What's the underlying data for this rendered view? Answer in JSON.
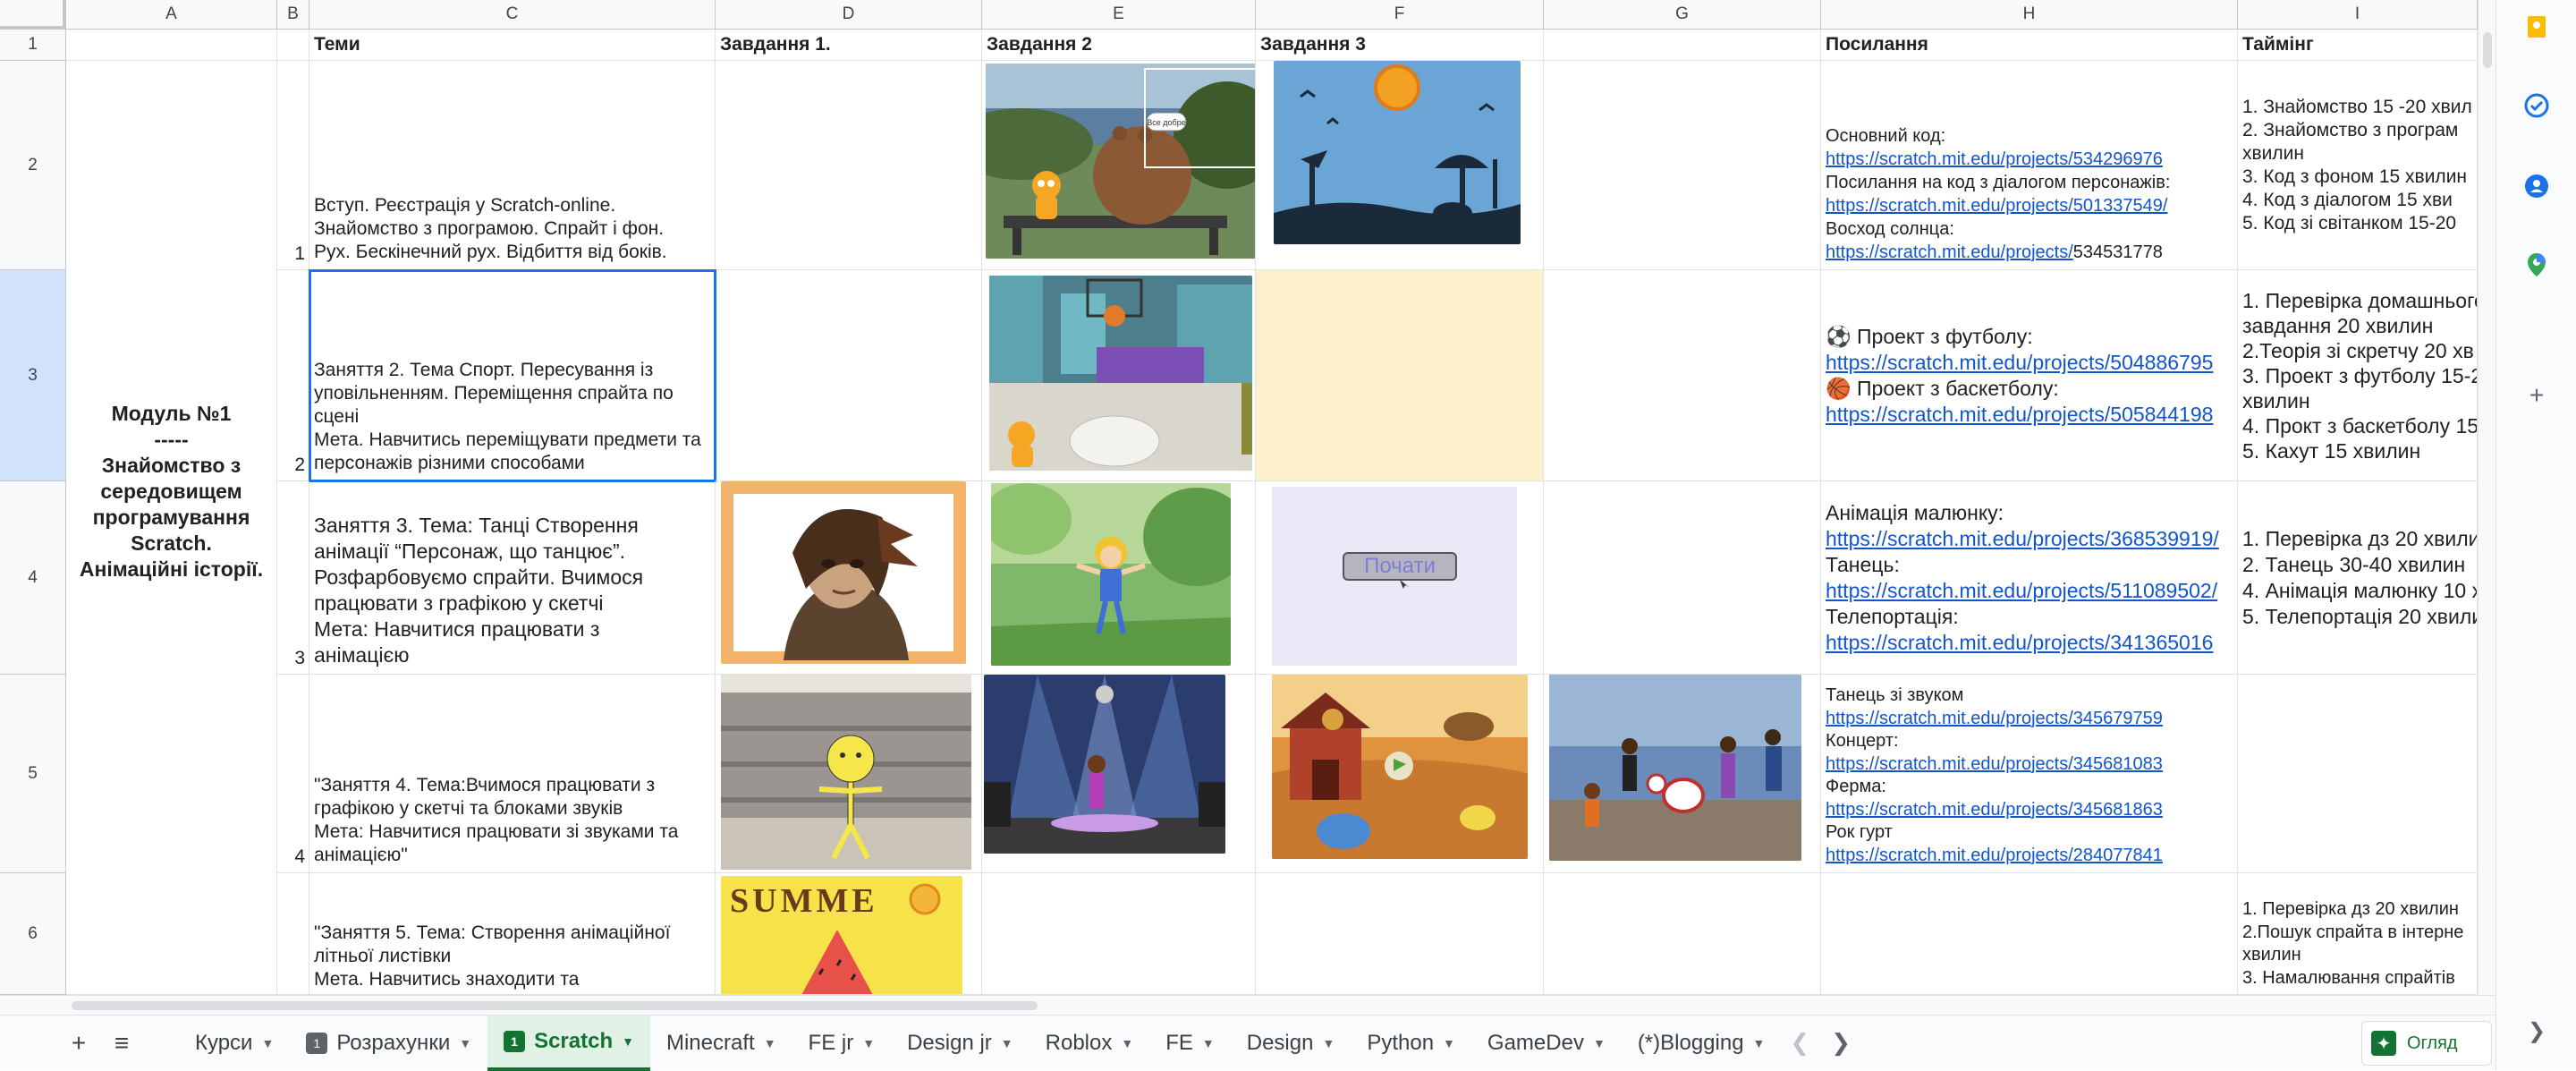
{
  "columns": [
    "A",
    "B",
    "C",
    "D",
    "E",
    "F",
    "G",
    "H",
    "I"
  ],
  "rows": [
    "1",
    "2",
    "3",
    "4",
    "5",
    "6"
  ],
  "headers": {
    "c": "Теми",
    "d": "Завдання 1.",
    "e": "Завдання 2",
    "f": "Завдання 3",
    "h": "Посилання",
    "i": "Таймінг"
  },
  "module": {
    "title": "Модуль №1",
    "dashes": "-----",
    "l1": "Знайомство з",
    "l2": "середовищем",
    "l3": "програмування",
    "l4": "Scratch.",
    "l5": "Анімаційні історії."
  },
  "lessons": [
    {
      "num": "1",
      "topic": [
        "Вступ. Реєстрація у Scratch-online.",
        "Знайомство з програмою. Спрайт і фон.",
        "Рух. Бескінечний рух. Відбиття від боків."
      ],
      "links": [
        {
          "label": "Основний код:",
          "url": "https://scratch.mit.edu/projects/534296976"
        },
        {
          "label": "Посилання на код з діалогом персонажів:",
          "url": "https://scratch.mit.edu/projects/501337549/"
        },
        {
          "label": "Восход солнца:",
          "url": "https://scratch.mit.edu/projects/",
          "tail": "534531778"
        }
      ],
      "timing": [
        "1. Знайомство 15 -20 хвил",
        "2. Знайомство з програм",
        "хвилин",
        "3. Код з фоном 15 хвилин",
        "4. Код з діалогом 15 хви",
        "5. Код зі світанком 15-20"
      ]
    },
    {
      "num": "2",
      "topic": [
        "Заняття 2. Тема Спорт.  Пересування із",
        "уповільненням. Переміщення спрайта  по",
        "сцені",
        "Мета. Навчитись переміщувати предмети та",
        "персонажів різними способами"
      ],
      "links": [
        {
          "label": "⚽ Проект з футболу:",
          "url": "https://scratch.mit.edu/projects/504886795"
        },
        {
          "label": "🏀 Проект з баскетболу:",
          "url": "https://scratch.mit.edu/projects/505844198"
        }
      ],
      "timing": [
        "1. Перевірка домашнього",
        "завдання 20 хвилин",
        "2.Теорія зі скретчу 20 хв",
        "3. Проект з футболу 15-2",
        "хвилин",
        "4. Прокт з баскетболу 15",
        "5. Кахут 15 хвилин"
      ]
    },
    {
      "num": "3",
      "topic": [
        "Заняття 3. Тема: Танці Створення",
        "анімації “Персонаж, що танцює”.",
        "Розфарбовуємо спрайти. Вчимося",
        "працювати з графікою у скетчі",
        "Мета: Навчитися працювати з",
        "анімацією"
      ],
      "links": [
        {
          "label": "Анімація малюнку:",
          "url": "https://scratch.mit.edu/projects/368539919/"
        },
        {
          "label": "Танець:",
          "url": "https://scratch.mit.edu/projects/511089502/"
        },
        {
          "label": "Телепортація:",
          "url": "https://scratch.mit.edu/projects/341365016"
        }
      ],
      "timing": [
        "1. Перевірка дз 20 хвили",
        "2. Танець 30-40 хвилин",
        "4. Анімація малюнку 10 х",
        "5. Телепортація 20 хвили"
      ],
      "start_label": "Почати"
    },
    {
      "num": "4",
      "topic": [
        "\"Заняття 4. Тема:Вчимося працювати з",
        "графікою у скетчі та блоками звуків",
        "Мета: Навчитися працювати зі звуками та",
        "анімацією\""
      ],
      "links": [
        {
          "label": "Танець зі звуком",
          "url": "https://scratch.mit.edu/projects/345679759"
        },
        {
          "label": "Концерт:",
          "url": "https://scratch.mit.edu/projects/345681083"
        },
        {
          "label": "Ферма:",
          "url": "https://scratch.mit.edu/projects/345681863"
        },
        {
          "label": "Рок гурт",
          "url": "https://scratch.mit.edu/projects/284077841"
        }
      ]
    },
    {
      "num": "",
      "topic": [
        "\"Заняття 5. Тема: Створення анімаційної",
        "літньої листівки",
        "Мета. Навчитись знаходити та"
      ],
      "timing": [
        "1. Перевірка дз 20 хвилин",
        "2.Пошук спрайта в інтерне",
        "хвилин",
        "3. Намалювання спрайтів"
      ],
      "summer": "SUMME"
    }
  ],
  "speech_bubble": "Все добре",
  "tabs": [
    {
      "label": "Курси",
      "badge": ""
    },
    {
      "label": "Розрахунки",
      "badge": "1"
    },
    {
      "label": "Scratch",
      "badge": "1",
      "active": true
    },
    {
      "label": "Minecraft",
      "badge": ""
    },
    {
      "label": "FE jr",
      "badge": ""
    },
    {
      "label": "Design jr",
      "badge": ""
    },
    {
      "label": "Roblox",
      "badge": ""
    },
    {
      "label": "FE",
      "badge": ""
    },
    {
      "label": "Design",
      "badge": ""
    },
    {
      "label": "Python",
      "badge": ""
    },
    {
      "label": "GameDev",
      "badge": ""
    },
    {
      "label": "(*)Blogging",
      "badge": ""
    }
  ],
  "explore_label": "Огляд",
  "icons": {
    "add_sheet": "plus-icon",
    "all_sheets": "list-icon",
    "prev": "chevron-left-icon",
    "next": "chevron-right-icon",
    "keep": "keep-icon",
    "tasks": "tasks-icon",
    "contacts": "contacts-icon",
    "maps": "maps-icon",
    "addon": "plus-icon",
    "collapse": "chevron-right-icon"
  },
  "colors": {
    "accent": "#1a73e8",
    "link": "#1155cc",
    "active_tab": "#137333",
    "highlight_cell": "#fdf1cd"
  }
}
